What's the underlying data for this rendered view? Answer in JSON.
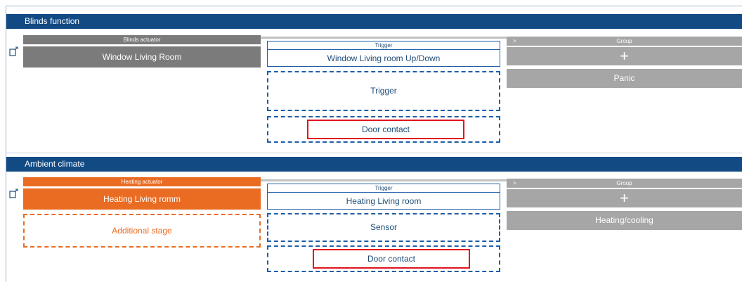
{
  "sections": [
    {
      "title": "Blinds function",
      "actuator": {
        "label": "Blinds actuator",
        "name": "Window Living Room"
      },
      "trigger": {
        "label": "Trigger",
        "name": "Window Living room Up/Down"
      },
      "slots": {
        "trigger": "Trigger",
        "door": "Door contact"
      },
      "group": {
        "arrow": ">",
        "label": "Group",
        "plus": "+",
        "name": "Panic"
      }
    },
    {
      "title": "Ambient climate",
      "actuator": {
        "label": "Heating actuator",
        "name": "Heating Living romm",
        "additional": "Additional stage"
      },
      "trigger": {
        "label": "Trigger",
        "name": "Heating Living room"
      },
      "slots": {
        "sensor": "Sensor",
        "door": "Door contact"
      },
      "group": {
        "arrow": ">",
        "label": "Group",
        "plus": "+",
        "name": "Heating/cooling"
      }
    }
  ],
  "colors": {
    "header": "#124a84",
    "blinds_actuator": "#7b7b7b",
    "heating_actuator": "#ea6c22",
    "group": "#a6a6a6",
    "highlight": "#e0141e"
  }
}
